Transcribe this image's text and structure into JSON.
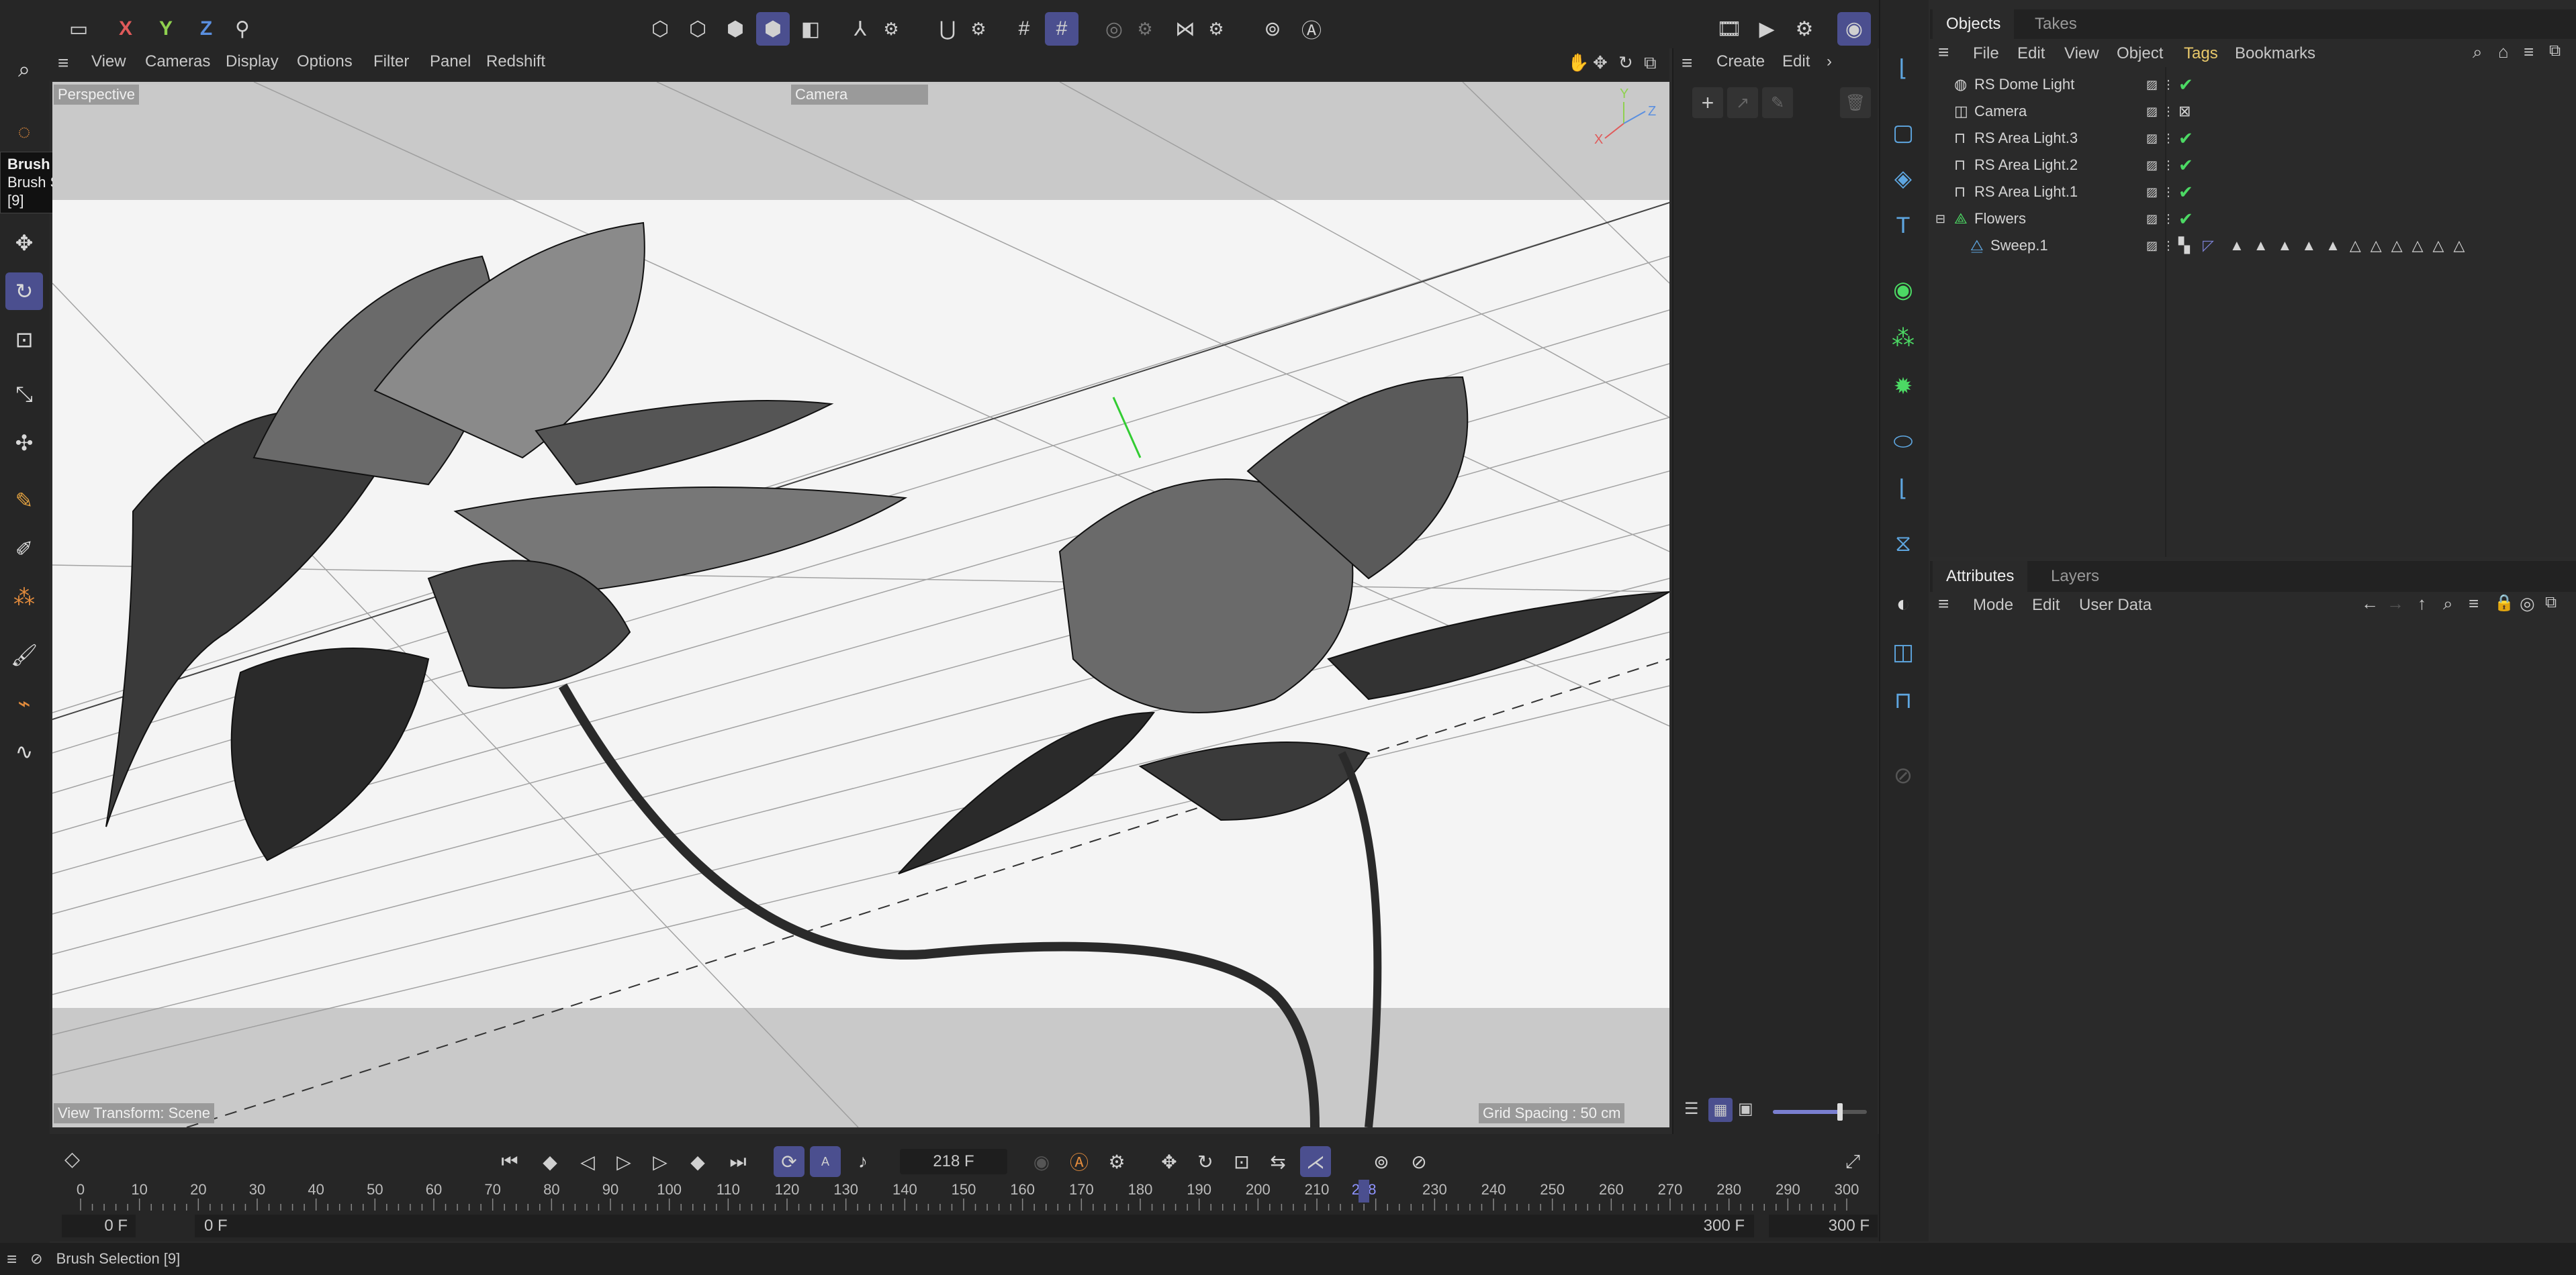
{
  "top_toolbar": {
    "axis_x": "X",
    "axis_y": "Y",
    "axis_z": "Z"
  },
  "viewport_menu": {
    "items": [
      "View",
      "Cameras",
      "Display",
      "Options",
      "Filter",
      "Panel",
      "Redshift"
    ]
  },
  "viewport": {
    "label": "Perspective",
    "camera_field": "Camera",
    "view_transform": "View Transform: Scene",
    "grid_spacing": "Grid Spacing : 50 cm"
  },
  "tooltip": {
    "title": "Brush Selection",
    "line2": "Brush Selection",
    "shortcut": "[9]"
  },
  "create_panel": {
    "create": "Create",
    "edit": "Edit"
  },
  "objects_panel": {
    "tabs": [
      "Objects",
      "Takes"
    ],
    "menu": [
      "File",
      "Edit",
      "View",
      "Object",
      "Tags",
      "Bookmarks"
    ],
    "rows": [
      {
        "name": "RS Dome Light",
        "icon": "dome-light-icon",
        "check": "✔"
      },
      {
        "name": "Camera",
        "icon": "camera-icon",
        "check": ""
      },
      {
        "name": "RS Area Light.3",
        "icon": "area-light-icon",
        "check": "✔"
      },
      {
        "name": "RS Area Light.2",
        "icon": "area-light-icon",
        "check": "✔"
      },
      {
        "name": "RS Area Light.1",
        "icon": "area-light-icon",
        "check": "✔"
      },
      {
        "name": "Flowers",
        "icon": "null-icon",
        "check": "✔"
      },
      {
        "name": "Sweep.1",
        "icon": "sweep-icon",
        "check": ""
      }
    ]
  },
  "attributes_panel": {
    "tabs": [
      "Attributes",
      "Layers"
    ],
    "menu": [
      "Mode",
      "Edit",
      "User Data"
    ]
  },
  "timeline": {
    "current_frame": "218 F",
    "ticks": [
      "0",
      "10",
      "20",
      "30",
      "40",
      "50",
      "60",
      "70",
      "80",
      "90",
      "100",
      "110",
      "120",
      "130",
      "140",
      "150",
      "160",
      "170",
      "180",
      "190",
      "200",
      "210",
      "218",
      "230",
      "240",
      "250",
      "260",
      "270",
      "280",
      "290",
      "300"
    ],
    "start_min": "0 F",
    "start": "0 F",
    "end": "300 F",
    "end_max": "300 F",
    "playhead_value": 218,
    "max_frame": 300
  },
  "status_bar": {
    "text": "Brush Selection [9]"
  },
  "colors": {
    "accent": "#4b4f8f",
    "check_green": "#4cd964",
    "tags_yellow": "#e8c86a",
    "viewport_bg": "#f4f4f4"
  }
}
